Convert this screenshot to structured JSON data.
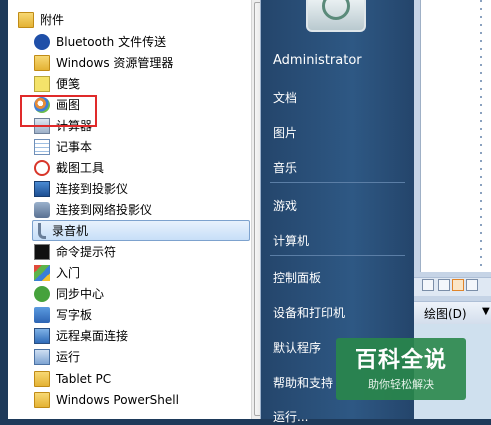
{
  "start_menu": {
    "programs": [
      {
        "label": "附件",
        "icon": "folder-icon"
      },
      {
        "label": "Bluetooth 文件传送",
        "icon": "bluetooth-icon"
      },
      {
        "label": "Windows 资源管理器",
        "icon": "explorer-icon"
      },
      {
        "label": "便笺",
        "icon": "sticky-notes-icon"
      },
      {
        "label": "画图",
        "icon": "paint-icon"
      },
      {
        "label": "计算器",
        "icon": "calculator-icon"
      },
      {
        "label": "记事本",
        "icon": "notepad-icon"
      },
      {
        "label": "截图工具",
        "icon": "snipping-tool-icon"
      },
      {
        "label": "连接到投影仪",
        "icon": "projector-icon"
      },
      {
        "label": "连接到网络投影仪",
        "icon": "network-projector-icon"
      },
      {
        "label": "录音机",
        "icon": "sound-recorder-icon"
      },
      {
        "label": "命令提示符",
        "icon": "command-prompt-icon"
      },
      {
        "label": "入门",
        "icon": "getting-started-icon"
      },
      {
        "label": "同步中心",
        "icon": "sync-center-icon"
      },
      {
        "label": "写字板",
        "icon": "wordpad-icon"
      },
      {
        "label": "远程桌面连接",
        "icon": "remote-desktop-icon"
      },
      {
        "label": "运行",
        "icon": "run-icon"
      },
      {
        "label": "Tablet PC",
        "icon": "folder-icon"
      },
      {
        "label": "Windows PowerShell",
        "icon": "folder-icon"
      }
    ],
    "selected_item": "录音机",
    "highlighted_item": "画图"
  },
  "right_pane": {
    "user": "Administrator",
    "items": [
      "文档",
      "图片",
      "音乐",
      "游戏",
      "计算机",
      "控制面板",
      "设备和打印机",
      "默认程序",
      "帮助和支持",
      "运行..."
    ]
  },
  "background_window": {
    "draw_menu": "绘图(D)",
    "draw_arrow": "▼"
  },
  "watermark": {
    "title": "百科全说",
    "subtitle": "助你轻松解决"
  },
  "colors": {
    "highlight_border": "#e02a2a",
    "right_pane_bg": "#2e5884",
    "watermark_bg": "#29874a"
  }
}
